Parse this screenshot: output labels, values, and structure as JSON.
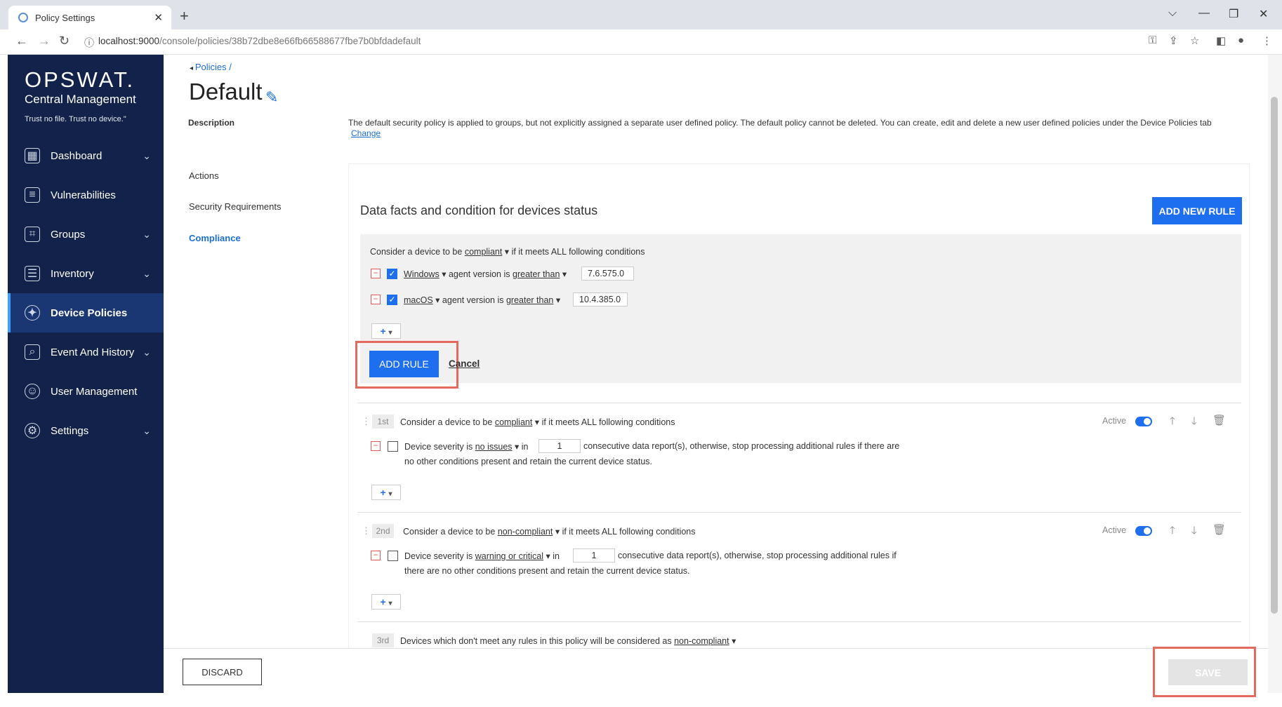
{
  "browser": {
    "tab_title": "Policy Settings",
    "url_host": "localhost:9000",
    "url_path": "/console/policies/38b72dbe8e66fb66588677fbe7b0bfdadefault"
  },
  "sidebar": {
    "logo": "OPSWAT.",
    "product": "Central Management",
    "tagline": "Trust no file. Trust no device.\"",
    "items": [
      {
        "label": "Dashboard"
      },
      {
        "label": "Vulnerabilities"
      },
      {
        "label": "Groups"
      },
      {
        "label": "Inventory"
      },
      {
        "label": "Device Policies"
      },
      {
        "label": "Event And History"
      },
      {
        "label": "User Management"
      },
      {
        "label": "Settings"
      }
    ]
  },
  "breadcrumb": {
    "link": "Policies",
    "sep": "/"
  },
  "page": {
    "title": "Default",
    "desc_label": "Description",
    "desc_text": "The default security policy is applied to groups, but not explicitly assigned a separate user defined policy. The default policy cannot be deleted. You can create, edit and delete a new user defined policies under the Device Policies tab",
    "desc_change": "Change"
  },
  "subnav": {
    "actions": "Actions",
    "security": "Security Requirements",
    "compliance": "Compliance"
  },
  "panel": {
    "title": "Data facts and condition for devices status",
    "add_new_rule": "ADD NEW RULE"
  },
  "editor": {
    "prefix": "Consider a device to be",
    "status": "compliant",
    "suffix": "if it meets ALL following conditions",
    "conditions": [
      {
        "os": "Windows",
        "mid": "agent version is",
        "op": "greater than",
        "value": "7.6.575.0"
      },
      {
        "os": "macOS",
        "mid": "agent version is",
        "op": "greater than",
        "value": "10.4.385.0"
      }
    ],
    "add_rule": "ADD RULE",
    "cancel": "Cancel"
  },
  "rules": [
    {
      "rank": "1st",
      "prefix": "Consider a device to be",
      "status": "compliant",
      "suffix": "if it meets ALL following conditions",
      "active": "Active",
      "cond_pre": "Device severity is",
      "severity": "no issues",
      "in": "in",
      "count": "1",
      "line1": "consecutive data report(s), otherwise, stop processing additional rules if there are",
      "line2": "no other conditions present and retain the current device status."
    },
    {
      "rank": "2nd",
      "prefix": "Consider a device to be",
      "status": "non-compliant",
      "suffix": "if it meets ALL following conditions",
      "active": "Active",
      "cond_pre": "Device severity is",
      "severity": "warning or critical",
      "in": "in",
      "count": "1",
      "line1": "consecutive data report(s), otherwise, stop processing additional rules if",
      "line2": "there are no other conditions present and retain the current device status."
    },
    {
      "rank": "3rd",
      "text": "Devices which don't meet any rules in this policy will be considered as",
      "status": "non-compliant"
    }
  ],
  "footer": {
    "discard": "DISCARD",
    "save": "SAVE"
  }
}
